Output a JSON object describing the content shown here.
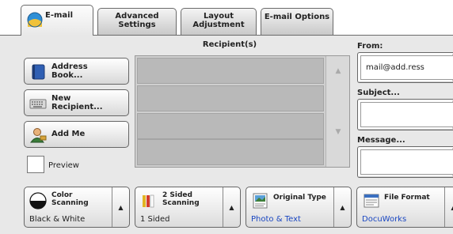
{
  "tabs": [
    {
      "label": "E-mail",
      "active": true
    },
    {
      "label": "Advanced Settings",
      "active": false
    },
    {
      "label": "Layout Adjustment",
      "active": false
    },
    {
      "label": "E-mail Options",
      "active": false
    }
  ],
  "tab_labels": {
    "email": "E-mail",
    "advanced_line1": "Advanced",
    "advanced_line2": "Settings",
    "layout_line1": "Layout",
    "layout_line2": "Adjustment",
    "email_options": "E-mail Options"
  },
  "recipients": {
    "header": "Recipient(s)",
    "rows": [
      "",
      "",
      "",
      ""
    ]
  },
  "left_buttons": {
    "address_book_line1": "Address",
    "address_book_line2": "Book...",
    "new_recipient_line1": "New",
    "new_recipient_line2": "Recipient...",
    "add_me": "Add Me",
    "preview": "Preview",
    "preview_checked": false
  },
  "fields": {
    "from_label": "From:",
    "from_value": "mail@add.ress",
    "subject_label": "Subject...",
    "subject_value": "",
    "message_label": "Message...",
    "message_value": ""
  },
  "bottom_buttons": {
    "color_line1": "Color",
    "color_line2": "Scanning",
    "color_value": "Black & White",
    "sided_line1": "2 Sided",
    "sided_line2": "Scanning",
    "sided_value": "1 Sided",
    "original_title": "Original Type",
    "original_value": "Photo & Text",
    "format_title": "File Format",
    "format_value": "DocuWorks"
  },
  "colors": {
    "accent_blue": "#1a47c2",
    "tab_bg": "#d8d8d8",
    "list_bg": "#b9b9b9"
  },
  "icons": [
    "email-icon",
    "address-book-icon",
    "keyboard-icon",
    "person-icon",
    "color-scanning-icon",
    "two-sided-icon",
    "original-type-icon",
    "file-format-icon",
    "scroll-up-icon",
    "scroll-down-icon",
    "arrow-up-icon"
  ]
}
